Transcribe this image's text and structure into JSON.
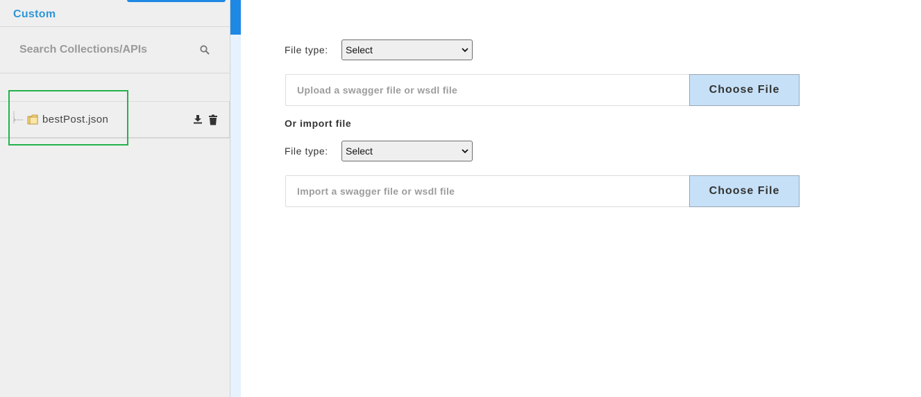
{
  "sidebar": {
    "title": "Custom",
    "search_placeholder": "Search Collections/APIs",
    "items": [
      {
        "label": "bestPost.json"
      }
    ]
  },
  "main": {
    "upload": {
      "file_type_label": "File type:",
      "select_value": "Select",
      "placeholder": "Upload a swagger file or wsdl file",
      "button_label": "Choose File"
    },
    "import_heading": "Or import file",
    "import": {
      "file_type_label": "File type:",
      "select_value": "Select",
      "placeholder": "Import a swagger file or wsdl file",
      "button_label": "Choose File"
    }
  },
  "colors": {
    "accent": "#1e88e5",
    "title": "#2c96d8",
    "button_bg": "#c6e0f7",
    "highlight": "#22b14c"
  },
  "icons": [
    "search-icon",
    "tree-connector-icon",
    "folder-icon",
    "download-icon",
    "trash-icon",
    "chevron-down-icon"
  ]
}
